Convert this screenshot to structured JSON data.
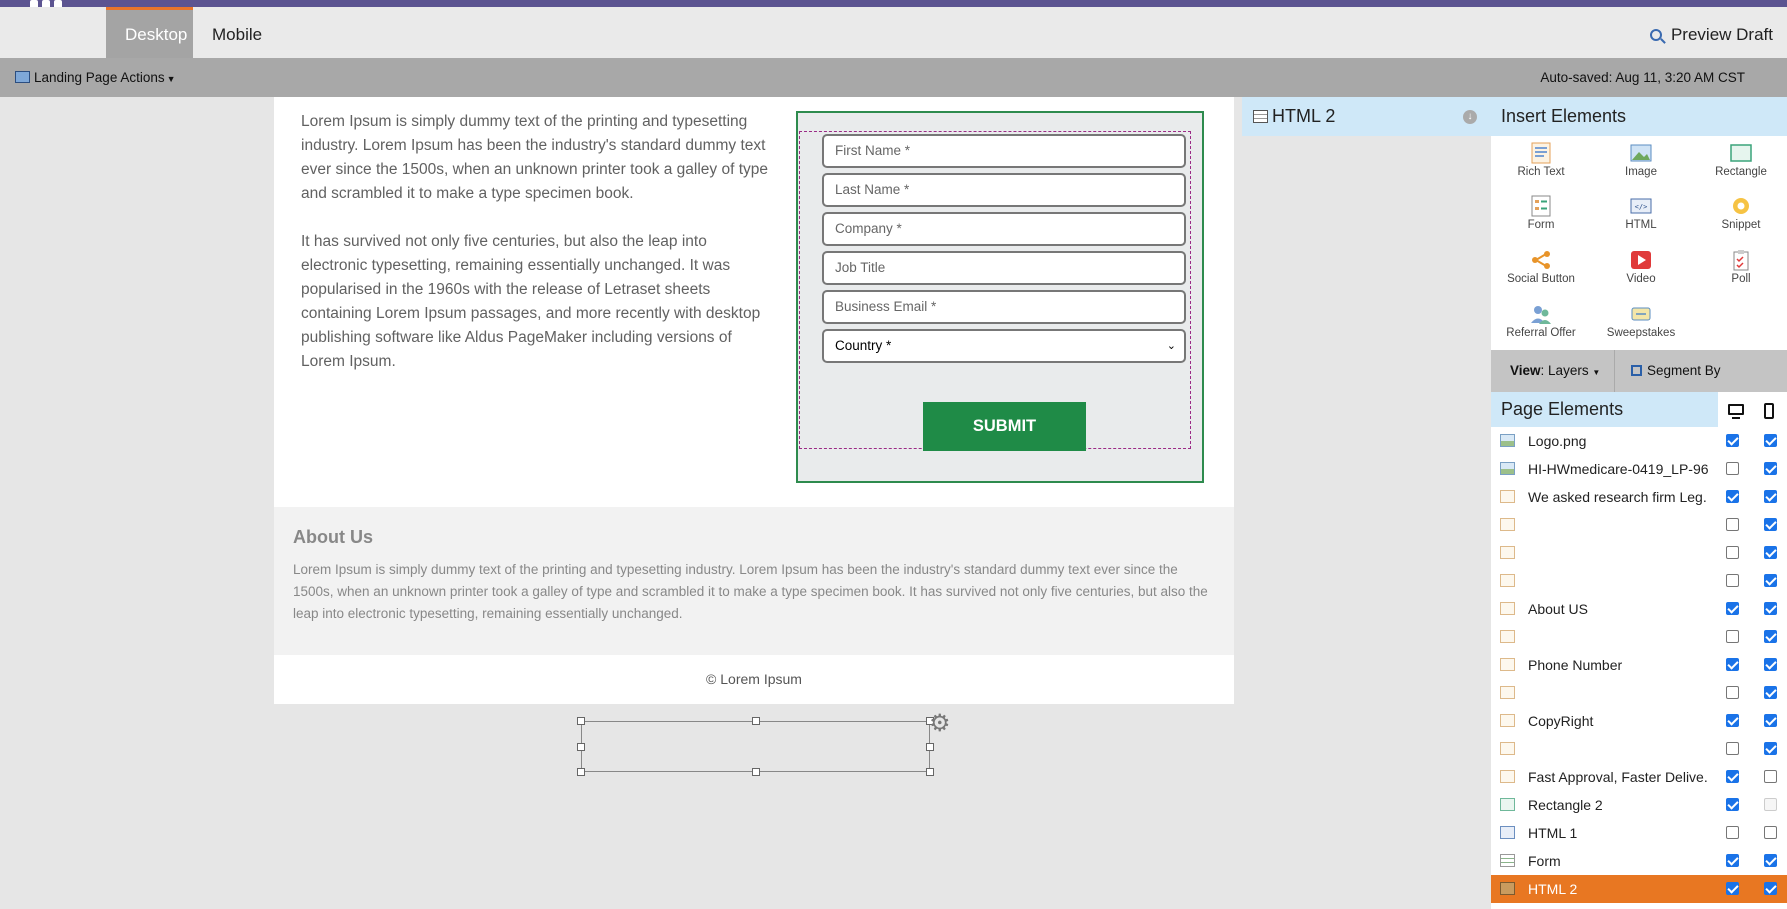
{
  "header": {
    "tabs": [
      {
        "label": "Desktop",
        "active": true
      },
      {
        "label": "Mobile",
        "active": false
      }
    ],
    "preview_label": "Preview Draft"
  },
  "actionbar": {
    "actions_label": "Landing Page Actions",
    "autosave": "Auto-saved: Aug 11, 3:20 AM CST"
  },
  "canvas": {
    "para1": "Lorem Ipsum is simply dummy text of the printing and typesetting industry. Lorem Ipsum has been the industry's standard dummy text ever since the 1500s, when an unknown printer took a galley of type and scrambled it to make a type specimen book.",
    "para2": "It has survived not only five centuries, but also the leap into electronic typesetting, remaining essentially unchanged. It was popularised in the 1960s with the release of Letraset sheets containing Lorem Ipsum passages, and more recently with desktop publishing software like Aldus PageMaker including versions of Lorem Ipsum.",
    "form": {
      "fields": [
        {
          "placeholder": "First Name *"
        },
        {
          "placeholder": "Last Name *"
        },
        {
          "placeholder": "Company *"
        },
        {
          "placeholder": "Job Title"
        },
        {
          "placeholder": "Business Email *"
        }
      ],
      "country_value": "Country *",
      "submit_label": "SUBMIT",
      "border_color": "#2e8b4e",
      "submit_color": "#1f8b47"
    },
    "about_title": "About Us",
    "about_text": "Lorem Ipsum is simply dummy text of the printing and typesetting industry. Lorem Ipsum has been the industry's standard dummy text ever since the 1500s, when an unknown printer took a galley of type and scrambled it to make a type specimen book. It has survived not only five centuries, but also the leap into electronic typesetting, remaining essentially unchanged.",
    "footer": "© Lorem Ipsum"
  },
  "selected_element": {
    "title": "HTML 2"
  },
  "insert": {
    "title": "Insert Elements",
    "items": [
      {
        "label": "Rich Text",
        "icon": "rich-text-icon"
      },
      {
        "label": "Image",
        "icon": "image-icon"
      },
      {
        "label": "Rectangle",
        "icon": "rectangle-icon"
      },
      {
        "label": "Form",
        "icon": "form-icon"
      },
      {
        "label": "HTML",
        "icon": "html-icon"
      },
      {
        "label": "Snippet",
        "icon": "snippet-icon"
      },
      {
        "label": "Social Button",
        "icon": "share-icon"
      },
      {
        "label": "Video",
        "icon": "video-icon"
      },
      {
        "label": "Poll",
        "icon": "poll-icon"
      },
      {
        "label": "Referral Offer",
        "icon": "referral-icon"
      },
      {
        "label": "Sweepstakes",
        "icon": "sweepstakes-icon"
      }
    ]
  },
  "view": {
    "view_key": "View",
    "view_value": "Layers",
    "segment_label": "Segment By"
  },
  "page_elements": {
    "title": "Page Elements",
    "rows": [
      {
        "name": "Logo.png",
        "icon": "img",
        "desktop": "on",
        "mobile": "on",
        "selected": false
      },
      {
        "name": "HI-HWmedicare-0419_LP-96...",
        "icon": "img",
        "desktop": "off",
        "mobile": "on",
        "selected": false
      },
      {
        "name": "We asked research firm Leg...",
        "icon": "text",
        "desktop": "on",
        "mobile": "on",
        "selected": false
      },
      {
        "name": "",
        "icon": "text",
        "desktop": "off",
        "mobile": "on",
        "selected": false
      },
      {
        "name": "",
        "icon": "text",
        "desktop": "off",
        "mobile": "on",
        "selected": false
      },
      {
        "name": "",
        "icon": "text",
        "desktop": "off",
        "mobile": "on",
        "selected": false
      },
      {
        "name": "About US",
        "icon": "text",
        "desktop": "on",
        "mobile": "on",
        "selected": false
      },
      {
        "name": "",
        "icon": "text",
        "desktop": "off",
        "mobile": "on",
        "selected": false
      },
      {
        "name": "Phone Number",
        "icon": "text",
        "desktop": "on",
        "mobile": "on",
        "selected": false
      },
      {
        "name": "",
        "icon": "text",
        "desktop": "off",
        "mobile": "on",
        "selected": false
      },
      {
        "name": "CopyRight",
        "icon": "text",
        "desktop": "on",
        "mobile": "on",
        "selected": false
      },
      {
        "name": "",
        "icon": "text",
        "desktop": "off",
        "mobile": "on",
        "selected": false
      },
      {
        "name": "Fast Approval, Faster Delive...",
        "icon": "text",
        "desktop": "on",
        "mobile": "off",
        "selected": false
      },
      {
        "name": "Rectangle 2",
        "icon": "rect",
        "desktop": "on",
        "mobile": "dis",
        "selected": false
      },
      {
        "name": "HTML 1",
        "icon": "code",
        "desktop": "off",
        "mobile": "off",
        "selected": false
      },
      {
        "name": "Form",
        "icon": "form",
        "desktop": "on",
        "mobile": "on",
        "selected": false
      },
      {
        "name": "HTML 2",
        "icon": "html2",
        "desktop": "on",
        "mobile": "on",
        "selected": true
      }
    ]
  },
  "colors": {
    "brand": "#5c5491",
    "tab_accent": "#e8752b",
    "selected_row": "#e87722",
    "checkbox": "#1a73e8",
    "panel_header": "#cfe8f8"
  }
}
